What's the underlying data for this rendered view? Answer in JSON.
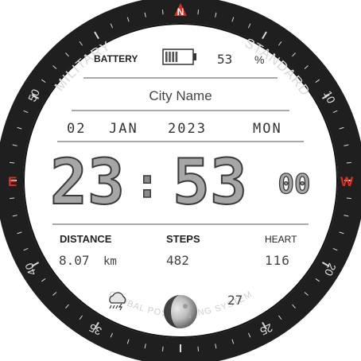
{
  "bezel": {
    "top_text_left": "MILITARY",
    "top_text_right": "STANDARD",
    "bottom_text": "GLOBAL POSITIONING SYSTEM",
    "compass": {
      "n": "N",
      "e": "E",
      "w": "W"
    },
    "numbers": {
      "n10": "10",
      "n20": "20",
      "n25": "25",
      "n35": "35",
      "n40": "40",
      "n50": "50"
    },
    "accent_color": "#e8281c"
  },
  "battery": {
    "label": "BATTERY",
    "value": "53",
    "unit": "%",
    "level": 0.53,
    "icon": "battery-icon"
  },
  "city": {
    "name": "City Name"
  },
  "date": {
    "day": "02",
    "month": "JAN",
    "year": "2023",
    "weekday": "MON"
  },
  "time": {
    "hours": "23",
    "separator": ":",
    "minutes": "53",
    "seconds": "00"
  },
  "stats": {
    "distance": {
      "label": "DISTANCE",
      "value": "8.07",
      "unit": "km"
    },
    "steps": {
      "label": "STEPS",
      "value": "482"
    },
    "heart": {
      "label": "HEART",
      "value": "116"
    }
  },
  "weather": {
    "icon": "storm-cloud-icon",
    "temperature": "27"
  },
  "moon": {
    "icon": "moon-phase-icon"
  }
}
